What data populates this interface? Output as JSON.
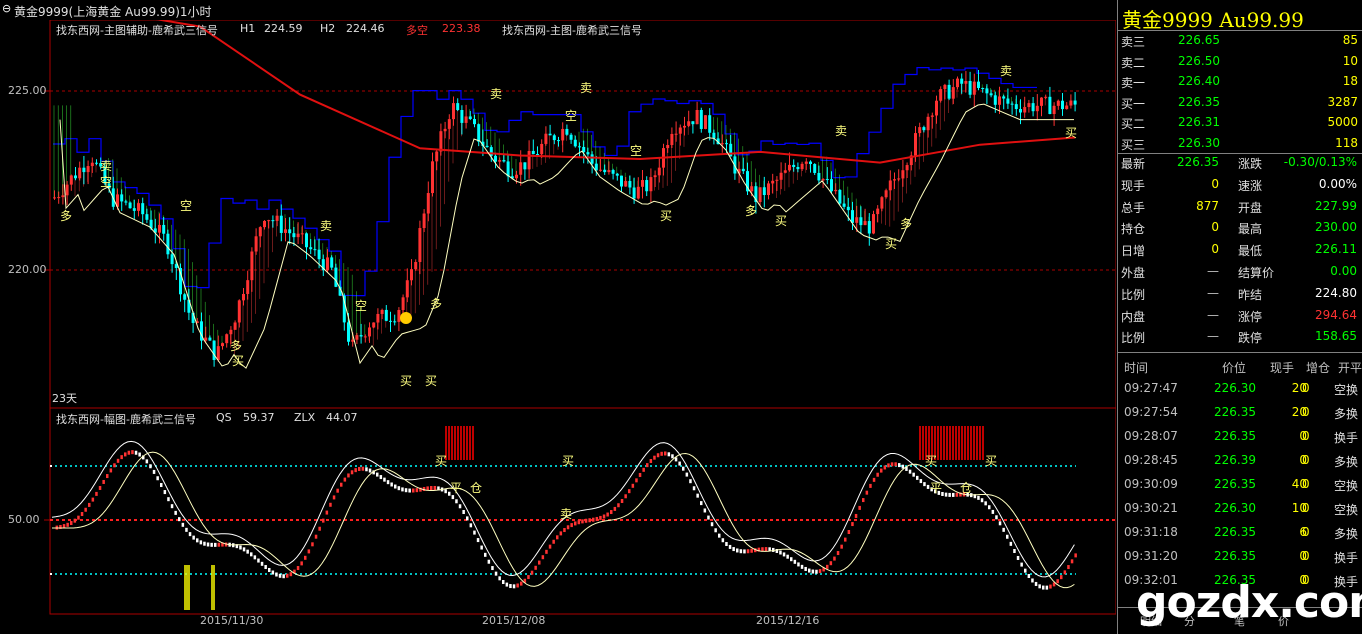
{
  "window": {
    "title": "黄金9999(上海黄金 Au99.99)1小时"
  },
  "main_chart": {
    "indicator_name": "找东西网-主图辅助-鹿希武三信号",
    "h1_label": "H1",
    "h1_value": "224.59",
    "h2_label": "H2",
    "h2_value": "224.46",
    "dk_label": "多空",
    "dk_value": "223.38",
    "indicator_name2": "找东西网-主图-鹿希武三信号",
    "y_ticks": [
      "225.00",
      "220.00"
    ],
    "days_label": "23天",
    "signal_labels": {
      "buy": "买",
      "sell": "卖",
      "long": "多",
      "short": "空"
    }
  },
  "sub_chart": {
    "indicator_name": "找东西网-幅图-鹿希武三信号",
    "qs_label": "QS",
    "qs_value": "59.37",
    "zlx_label": "ZLX",
    "zlx_value": "44.07",
    "y_tick": "50.00",
    "signal_labels": {
      "ping": "平",
      "cang": "仓",
      "sell": "卖",
      "buy": "买"
    }
  },
  "x_axis": [
    "2015/11/30",
    "2015/12/08",
    "2015/12/16"
  ],
  "quote": {
    "name": "黄金9999",
    "code": "Au99.99",
    "asks": [
      {
        "label": "卖三",
        "price": "226.65",
        "vol": "85"
      },
      {
        "label": "卖二",
        "price": "226.50",
        "vol": "10"
      },
      {
        "label": "卖一",
        "price": "226.40",
        "vol": "18"
      }
    ],
    "bids": [
      {
        "label": "买一",
        "price": "226.35",
        "vol": "3287"
      },
      {
        "label": "买二",
        "price": "226.31",
        "vol": "5000"
      },
      {
        "label": "买三",
        "price": "226.30",
        "vol": "118"
      }
    ],
    "stats": [
      {
        "l1": "最新",
        "v1": "226.35",
        "l2": "涨跌",
        "v2": "-0.30/0.13%"
      },
      {
        "l1": "现手",
        "v1": "0",
        "l2": "速涨",
        "v2": "0.00%"
      },
      {
        "l1": "总手",
        "v1": "877",
        "l2": "开盘",
        "v2": "227.99"
      },
      {
        "l1": "持仓",
        "v1": "0",
        "l2": "最高",
        "v2": "230.00"
      },
      {
        "l1": "日增",
        "v1": "0",
        "l2": "最低",
        "v2": "226.11"
      },
      {
        "l1": "外盘",
        "v1": "—",
        "l2": "结算价",
        "v2": "0.00"
      },
      {
        "l1": "比例",
        "v1": "—",
        "l2": "昨结",
        "v2": "224.80"
      },
      {
        "l1": "内盘",
        "v1": "—",
        "l2": "涨停",
        "v2": "294.64"
      },
      {
        "l1": "比例",
        "v1": "—",
        "l2": "跌停",
        "v2": "158.65"
      }
    ],
    "ticks_header": {
      "time": "时间",
      "price": "价位",
      "vol": "现手",
      "oi": "增仓",
      "type": "开平"
    },
    "ticks": [
      {
        "time": "09:27:47",
        "price": "226.30",
        "vol": "20",
        "oi": "0",
        "type": "空换"
      },
      {
        "time": "09:27:54",
        "price": "226.35",
        "vol": "20",
        "oi": "0",
        "type": "多换"
      },
      {
        "time": "09:28:07",
        "price": "226.35",
        "vol": "0",
        "oi": "0",
        "type": "换手"
      },
      {
        "time": "09:28:45",
        "price": "226.39",
        "vol": "0",
        "oi": "0",
        "type": "多换"
      },
      {
        "time": "09:30:09",
        "price": "226.35",
        "vol": "40",
        "oi": "0",
        "type": "空换"
      },
      {
        "time": "09:30:21",
        "price": "226.30",
        "vol": "10",
        "oi": "0",
        "type": "空换"
      },
      {
        "time": "09:31:18",
        "price": "226.35",
        "vol": "6",
        "oi": "0",
        "type": "多换"
      },
      {
        "time": "09:31:20",
        "price": "226.35",
        "vol": "0",
        "oi": "0",
        "type": "换手"
      },
      {
        "time": "09:32:01",
        "price": "226.35",
        "vol": "0",
        "oi": "0",
        "type": "换手"
      }
    ],
    "tabs": [
      "明细",
      "分",
      "笔",
      "价"
    ]
  },
  "watermark": "gozdx.com",
  "colors": {
    "up": "#ff3232",
    "down": "#00ffff",
    "ma": "#e01010",
    "resistance": "#0000ff",
    "signal": "#ffff80",
    "positive": "#ff3232",
    "negative": "#00ff00",
    "neutral": "#ffff00"
  }
}
